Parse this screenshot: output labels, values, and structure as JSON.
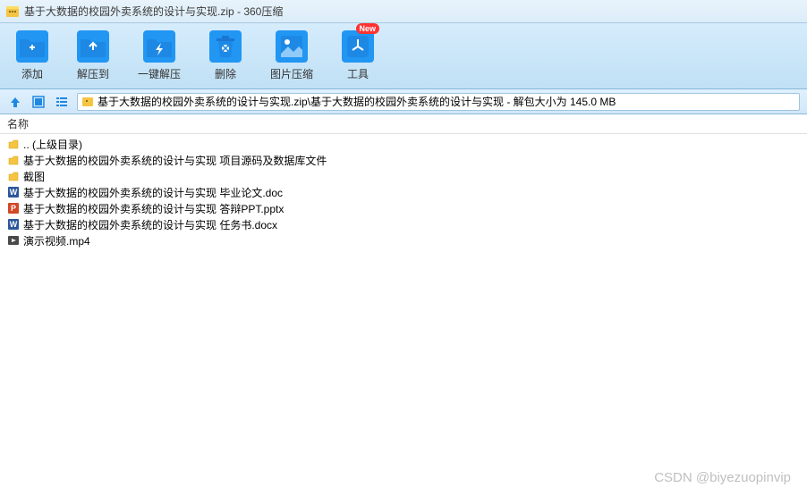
{
  "titlebar": {
    "title": "基于大数据的校园外卖系统的设计与实现.zip - 360压缩"
  },
  "toolbar": {
    "add": "添加",
    "extract": "解压到",
    "oneclick": "一键解压",
    "delete": "删除",
    "imgcompress": "图片压缩",
    "tools": "工具",
    "badge": "New"
  },
  "pathbar": {
    "text": "基于大数据的校园外卖系统的设计与实现.zip\\基于大数据的校园外卖系统的设计与实现 - 解包大小为 145.0 MB"
  },
  "header": {
    "name": "名称"
  },
  "files": [
    {
      "name": ".. (上级目录)",
      "type": "up"
    },
    {
      "name": "基于大数据的校园外卖系统的设计与实现 项目源码及数据库文件",
      "type": "folder"
    },
    {
      "name": "截图",
      "type": "folder"
    },
    {
      "name": "基于大数据的校园外卖系统的设计与实现 毕业论文.doc",
      "type": "word"
    },
    {
      "name": "基于大数据的校园外卖系统的设计与实现 答辩PPT.pptx",
      "type": "ppt"
    },
    {
      "name": "基于大数据的校园外卖系统的设计与实现 任务书.docx",
      "type": "word"
    },
    {
      "name": "演示视频.mp4",
      "type": "video"
    }
  ],
  "watermark": "CSDN @biyezuopinvip"
}
